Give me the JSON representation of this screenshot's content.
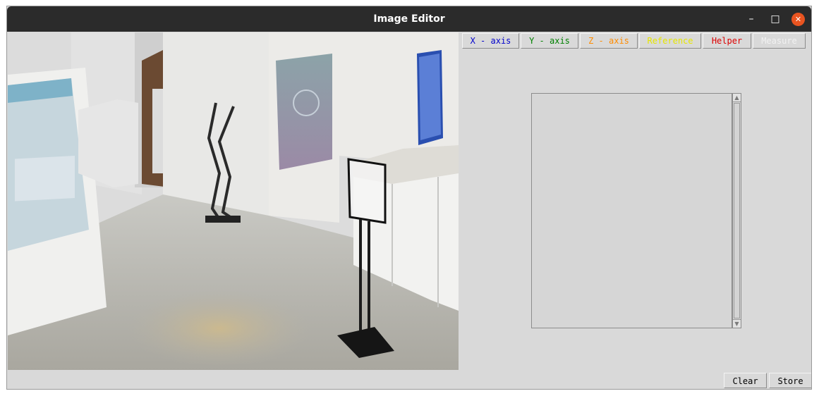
{
  "window": {
    "title": "Image Editor",
    "controls": {
      "minimize": "–",
      "maximize": "□",
      "close": "✕"
    }
  },
  "toolbar": {
    "buttons": [
      {
        "label": "X - axis",
        "color": "#0000cc"
      },
      {
        "label": "Y - axis",
        "color": "#008000"
      },
      {
        "label": "Z - axis",
        "color": "#ff8c00"
      },
      {
        "label": "Reference",
        "color": "#e6e600"
      },
      {
        "label": "Helper",
        "color": "#dd0000"
      },
      {
        "label": "Measure",
        "color": "#f2f2f2"
      }
    ]
  },
  "footer": {
    "clear_label": "Clear",
    "store_label": "Store"
  }
}
